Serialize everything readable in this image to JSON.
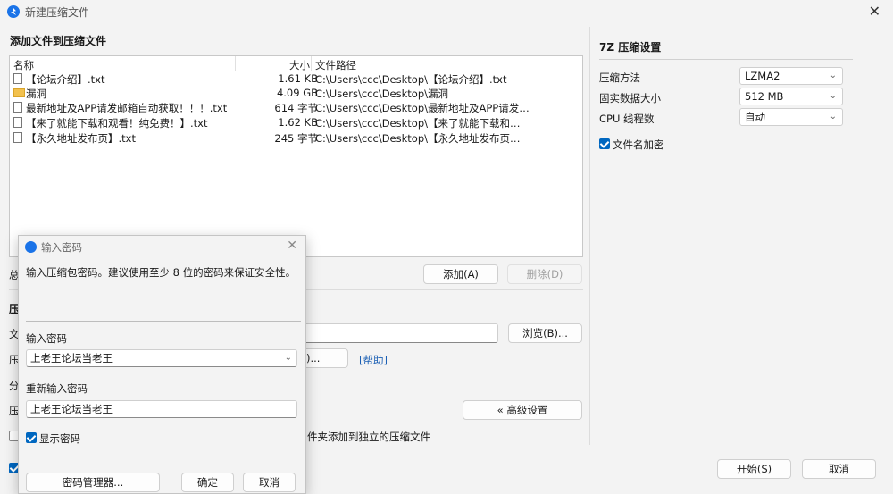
{
  "window": {
    "title": "新建压缩文件"
  },
  "files_section": {
    "title": "添加文件到压缩文件",
    "columns": {
      "name": "名称",
      "size": "大小",
      "path": "文件路径"
    },
    "files": [
      {
        "icon": "text-file-icon",
        "name": "【论坛介绍】.txt",
        "size": "1.61 KB",
        "path": "C:\\Users\\ccc\\Desktop\\【论坛介绍】.txt"
      },
      {
        "icon": "folder-icon",
        "name": "漏洞",
        "size": "4.09 GB",
        "path": "C:\\Users\\ccc\\Desktop\\漏洞"
      },
      {
        "icon": "text-file-icon",
        "name": "最新地址及APP请发邮箱自动获取！！！.txt",
        "size": "614 字节",
        "path": "C:\\Users\\ccc\\Desktop\\最新地址及APP请发邮..."
      },
      {
        "icon": "text-file-icon",
        "name": "【来了就能下载和观看！纯免费！】.txt",
        "size": "1.62 KB",
        "path": "C:\\Users\\ccc\\Desktop\\【来了就能下载和观看..."
      },
      {
        "icon": "text-file-icon",
        "name": "【永久地址发布页】.txt",
        "size": "245 字节",
        "path": "C:\\Users\\ccc\\Desktop\\【永久地址发布页】.txt"
      }
    ],
    "add_button": "添加(A)",
    "delete_button": "删除(D)",
    "total_label_fragment": "总"
  },
  "archive_section": {
    "title_fragment": "压",
    "row_file_fragment": "文",
    "row_format_fragment": "压",
    "format_suffix": ")...",
    "help_link": "[帮助]",
    "row_split_fragment": "分",
    "row_level_fragment": "压",
    "browse_button": "浏览(B)...",
    "advanced_button": "« 高级设置",
    "separate_archive_text": "件夹添加到独立的压缩文件"
  },
  "compression_settings": {
    "title": "7Z 压缩设置",
    "method_label": "压缩方法",
    "method_value": "LZMA2",
    "dict_label": "固实数据大小",
    "dict_value": "512 MB",
    "threads_label": "CPU 线程数",
    "threads_value": "自动",
    "encrypt_names_label": "文件名加密",
    "encrypt_names_checked": true
  },
  "footer": {
    "start_button": "开始(S)",
    "cancel_button": "取消"
  },
  "password_dialog": {
    "title": "输入密码",
    "description": "输入压缩包密码。建议使用至少 8 位的密码来保证安全性。",
    "password_label": "输入密码",
    "password_value": "上老王论坛当老王",
    "reenter_label": "重新输入密码",
    "reenter_value": "上老王论坛当老王",
    "show_password_label": "显示密码",
    "show_password_checked": true,
    "manager_button": "密码管理器...",
    "ok_button": "确定",
    "cancel_button": "取消"
  },
  "colors": {
    "accent": "#0067c0",
    "link": "#1a5fb4",
    "folder": "#f2c14e"
  }
}
